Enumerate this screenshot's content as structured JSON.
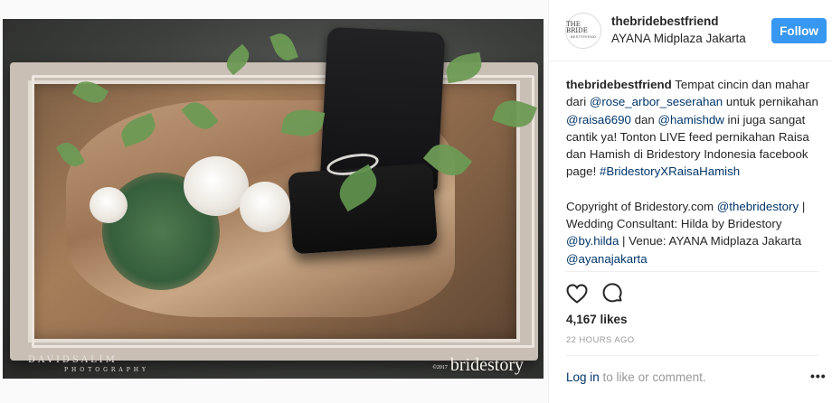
{
  "photo": {
    "photographer_watermark": "DAVIDSALIM",
    "photographer_sub": "PHOTOGRAPHY",
    "brand_year": "©2017",
    "brand_watermark": "bridestory"
  },
  "post_header": {
    "avatar_line1": "THE BRIDE",
    "avatar_line2": "BESTFRIEND",
    "username": "thebridebestfriend",
    "location": "AYANA Midplaza Jakarta",
    "follow_label": "Follow"
  },
  "caption": {
    "author": "thebridebestfriend",
    "p1_a": " Tempat cincin dan mahar dari ",
    "mention1": "@rose_arbor_seserahan",
    "p1_b": " untuk pernikahan ",
    "mention2": "@raisa6690",
    "p1_c": " dan ",
    "mention3": "@hamishdw",
    "p1_d": " ini juga sangat cantik ya! Tonton LIVE feed pernikahan Raisa dan Hamish di Bridestory Indonesia facebook page! ",
    "hashtag": "#BridestoryXRaisaHamish",
    "p2_a": "Copyright of Bridestory.com ",
    "mention4": "@thebridestory",
    "p2_b": " | Wedding Consultant: Hilda by Bridestory ",
    "mention5": "@by.hilda",
    "p2_c": " | Venue: AYANA Midplaza Jakarta ",
    "mention6": "@ayanajakarta"
  },
  "actions": {
    "like_icon": "heart-icon",
    "comment_icon": "comment-icon"
  },
  "likes": "4,167 likes",
  "timestamp": "22 HOURS AGO",
  "footer": {
    "login_link": "Log in",
    "login_text": " to like or comment.",
    "more_label": "•••"
  },
  "colors": {
    "follow_button": "#3897f0",
    "link": "#003569",
    "muted": "#999999",
    "text": "#262626"
  }
}
